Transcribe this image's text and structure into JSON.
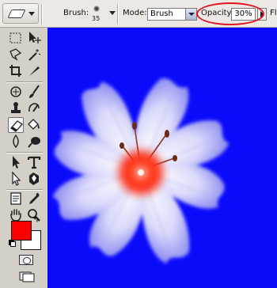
{
  "options_bar": {
    "brush_label": "Brush:",
    "brush_size": "35",
    "mode_label": "Mode:",
    "mode_value": "Brush",
    "opacity_label": "Opacity:",
    "opacity_value": "30%",
    "flow_label_partial": "Fl",
    "highlight_color": "#e0141e"
  },
  "toolbox": {
    "tools": [
      "rect-marquee",
      "move",
      "lasso",
      "magic-wand",
      "crop",
      "slice",
      "healing-brush",
      "brush",
      "clone-stamp",
      "history-brush",
      "eraser",
      "paint-bucket",
      "blur",
      "dodge",
      "path-select",
      "type",
      "direct-select",
      "shape",
      "notes",
      "eyedropper",
      "hand",
      "zoom"
    ],
    "active_tool": "eraser",
    "foreground_color": "#fe0000",
    "background_color": "#ffffff"
  },
  "canvas": {
    "background_color": "#0b0bfc",
    "content": "flower-photo"
  }
}
